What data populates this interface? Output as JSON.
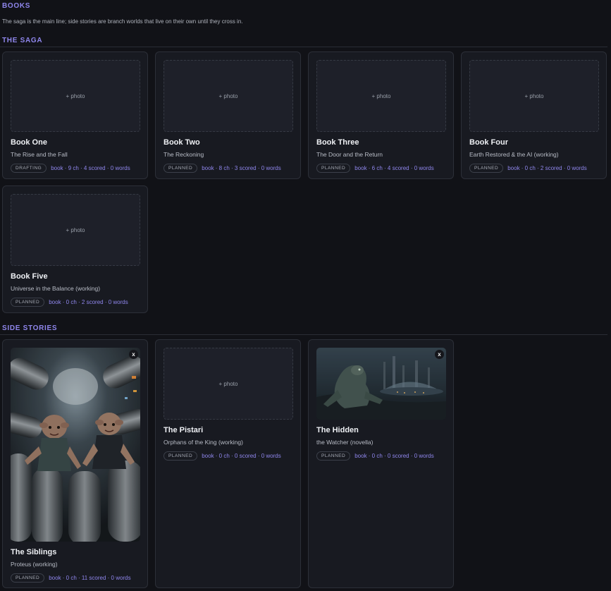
{
  "page": {
    "title": "BOOKS",
    "intro": "The saga is the main line; side stories are branch worlds that live on their own until they cross in.",
    "photo_label": "+ photo",
    "remove_label": "x"
  },
  "saga": {
    "heading": "THE SAGA",
    "books": [
      {
        "title": "Book One",
        "subtitle": "The Rise and the Fall",
        "status": "DRAFTING",
        "stats": "book · 9 ch · 4 scored · 0 words"
      },
      {
        "title": "Book Two",
        "subtitle": "The Reckoning",
        "status": "PLANNED",
        "stats": "book · 8 ch · 3 scored · 0 words"
      },
      {
        "title": "Book Three",
        "subtitle": "The Door and the Return",
        "status": "PLANNED",
        "stats": "book · 6 ch · 4 scored · 0 words"
      },
      {
        "title": "Book Four",
        "subtitle": "Earth Restored & the AI (working)",
        "status": "PLANNED",
        "stats": "book · 0 ch · 2 scored · 0 words"
      },
      {
        "title": "Book Five",
        "subtitle": "Universe in the Balance (working)",
        "status": "PLANNED",
        "stats": "book · 0 ch · 2 scored · 0 words"
      }
    ]
  },
  "side": {
    "heading": "SIDE STORIES",
    "stories": [
      {
        "title": "The Siblings",
        "subtitle": "Proteus (working)",
        "status": "PLANNED",
        "stats": "book · 0 ch · 11 scored · 0 words"
      },
      {
        "title": "The Pistari",
        "subtitle": "Orphans of the King (working)",
        "status": "PLANNED",
        "stats": "book · 0 ch · 0 scored · 0 words"
      },
      {
        "title": "The Hidden",
        "subtitle": "the Watcher (novella)",
        "status": "PLANNED",
        "stats": "book · 0 ch · 0 scored · 0 words"
      }
    ]
  }
}
